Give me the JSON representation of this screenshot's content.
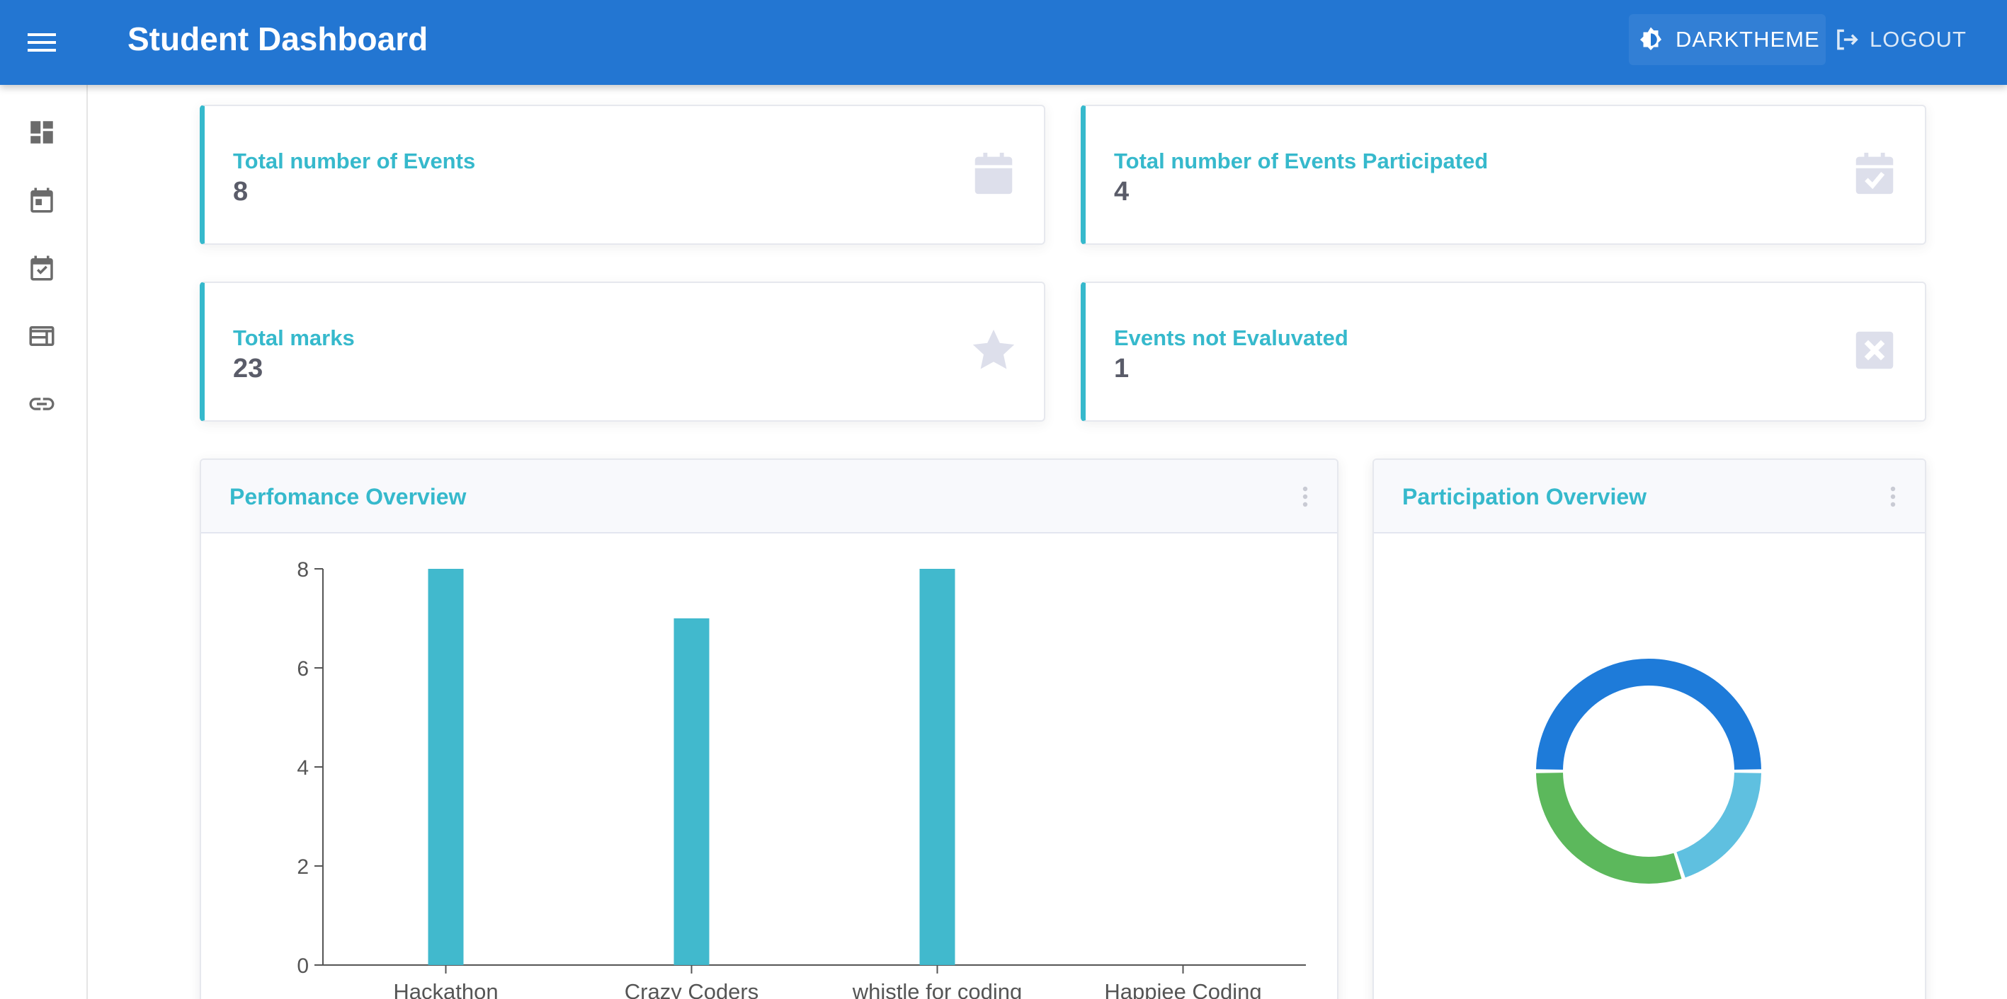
{
  "app": {
    "title": "Student Dashboard",
    "theme_label": "DARKTHEME",
    "logout_label": "LOGOUT"
  },
  "colors": {
    "appbar": "#2376d2",
    "accent": "#36b9cc",
    "bar": "#41b9cd",
    "text": "#5a5c69",
    "icon_muted": "#dddfeb"
  },
  "sidebar": {
    "items": [
      {
        "icon": "dashboard-icon"
      },
      {
        "icon": "calendar-event-icon"
      },
      {
        "icon": "calendar-check-icon"
      },
      {
        "icon": "web-layout-icon"
      },
      {
        "icon": "link-icon"
      }
    ]
  },
  "stats": [
    {
      "title": "Total number of Events",
      "value": "8",
      "icon": "calendar-icon"
    },
    {
      "title": "Total number of Events Participated",
      "value": "4",
      "icon": "calendar-check-icon"
    },
    {
      "title": "Total marks",
      "value": "23",
      "icon": "star-icon"
    },
    {
      "title": "Events not Evaluvated",
      "value": "1",
      "icon": "close-box-icon"
    }
  ],
  "performance": {
    "title": "Perfomance Overview"
  },
  "participation": {
    "title": "Participation Overview"
  },
  "chart_data": [
    {
      "type": "bar",
      "title": "Perfomance Overview",
      "categories": [
        "Hackathon",
        "Crazy Coders",
        "whistle for coding",
        "Happiee Coding"
      ],
      "values": [
        8,
        7,
        8,
        0
      ],
      "ylim": [
        0,
        8
      ],
      "yticks": [
        0,
        2,
        4,
        6,
        8
      ],
      "grid": false,
      "color": "#41b9cd"
    },
    {
      "type": "pie",
      "title": "Participation Overview",
      "donut": true,
      "slices": [
        {
          "value": 50,
          "color": "#1e7bd9"
        },
        {
          "value": 20,
          "color": "#5fc0e0"
        },
        {
          "value": 30,
          "color": "#5cb85c"
        }
      ]
    }
  ]
}
